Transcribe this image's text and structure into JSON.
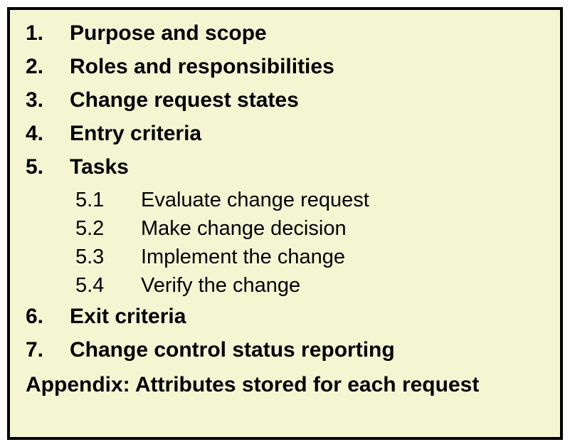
{
  "items": [
    {
      "num": "1.",
      "label": "Purpose and scope"
    },
    {
      "num": "2.",
      "label": "Roles and responsibilities"
    },
    {
      "num": "3.",
      "label": "Change request states"
    },
    {
      "num": "4.",
      "label": "Entry criteria"
    },
    {
      "num": "5.",
      "label": "Tasks"
    }
  ],
  "subitems": [
    {
      "num": "5.1",
      "label": "Evaluate change request"
    },
    {
      "num": "5.2",
      "label": "Make change decision"
    },
    {
      "num": "5.3",
      "label": "Implement the change"
    },
    {
      "num": "5.4",
      "label": "Verify the change"
    }
  ],
  "items_after": [
    {
      "num": "6.",
      "label": "Exit criteria"
    },
    {
      "num": "7.",
      "label": "Change control status reporting"
    }
  ],
  "appendix": "Appendix: Attributes stored for each request"
}
